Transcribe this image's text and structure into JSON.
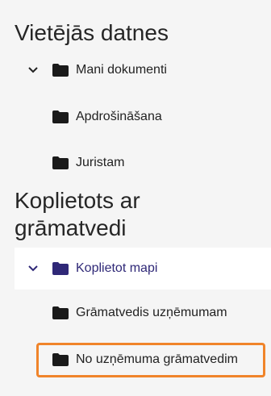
{
  "sections": {
    "local": {
      "title": "Vietējās datnes",
      "root": {
        "label": "Mani dokumenti",
        "expanded": true
      },
      "children": [
        {
          "label": "Apdrošināšana"
        },
        {
          "label": "Juristam"
        }
      ]
    },
    "shared": {
      "title": "Koplietots ar grāmatvedi",
      "root": {
        "label": "Koplietot mapi",
        "expanded": true,
        "selected": true
      },
      "children": [
        {
          "label": "Grāmatvedis uzņēmumam"
        },
        {
          "label": "No uzņēmuma grāmatvedim",
          "highlighted": true
        }
      ]
    }
  },
  "icons": {
    "folder": "folder-icon",
    "chevron": "chevron-down-icon"
  },
  "colors": {
    "selected_text": "#2f2877",
    "highlight_border": "#f0842a",
    "background": "#f5f5f5"
  }
}
